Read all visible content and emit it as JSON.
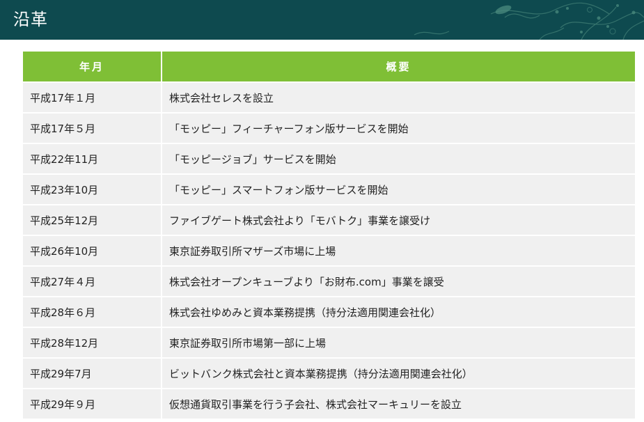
{
  "header": {
    "title": "沿革"
  },
  "table": {
    "columns": [
      "年月",
      "概要"
    ],
    "rows": [
      {
        "date": "平成17年１月",
        "summary": "株式会社セレスを設立"
      },
      {
        "date": "平成17年５月",
        "summary": "「モッピー」フィーチャーフォン版サービスを開始"
      },
      {
        "date": "平成22年11月",
        "summary": "「モッピージョブ」サービスを開始"
      },
      {
        "date": "平成23年10月",
        "summary": "「モッピー」スマートフォン版サービスを開始"
      },
      {
        "date": "平成25年12月",
        "summary": "ファイブゲート株式会社より「モバトク」事業を譲受け"
      },
      {
        "date": "平成26年10月",
        "summary": "東京証券取引所マザーズ市場に上場"
      },
      {
        "date": "平成27年４月",
        "summary": "株式会社オープンキューブより「お財布.com」事業を譲受"
      },
      {
        "date": "平成28年６月",
        "summary": "株式会社ゆめみと資本業務提携（持分法適用関連会社化）"
      },
      {
        "date": "平成28年12月",
        "summary": "東京証券取引所市場第一部に上場"
      },
      {
        "date": "平成29年7月",
        "summary": "ビットバンク株式会社と資本業務提携（持分法適用関連会社化）"
      },
      {
        "date": "平成29年９月",
        "summary": "仮想通貨取引事業を行う子会社、株式会社マーキュリーを設立"
      }
    ]
  },
  "colors": {
    "header_bg": "#0e4a4f",
    "table_header_bg": "#7fbf36",
    "row_bg": "#f0f0f0"
  }
}
